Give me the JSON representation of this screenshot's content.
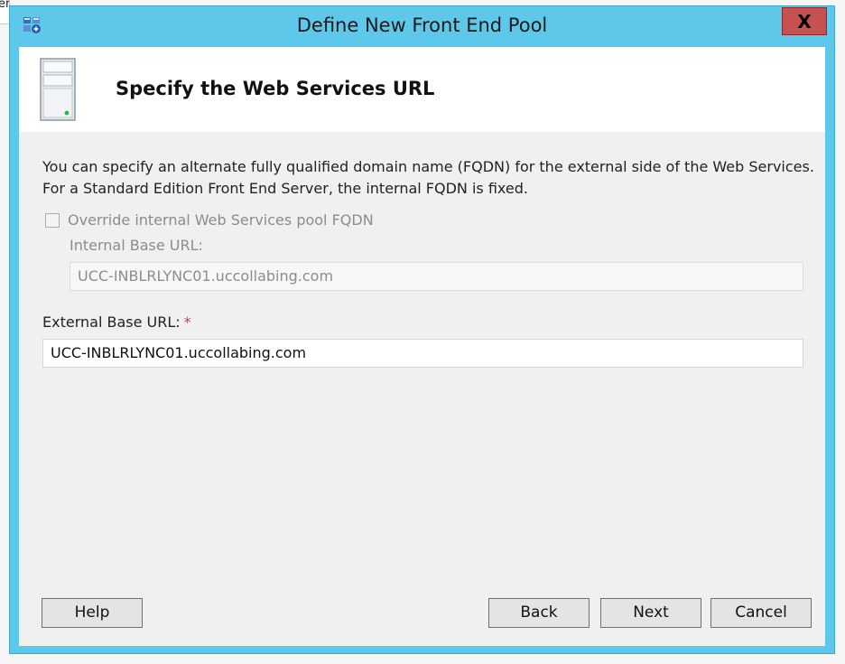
{
  "background": {
    "partial_text": "er"
  },
  "dialog": {
    "title": "Define New Front End Pool",
    "close_label": "X"
  },
  "header": {
    "title": "Specify the Web Services URL"
  },
  "description": {
    "line1": "You can specify an alternate fully qualified domain name (FQDN) for the external side of the Web Services.",
    "line2": "For a Standard Edition Front End Server, the internal FQDN is fixed."
  },
  "override": {
    "label": "Override internal Web Services pool FQDN",
    "checked": false
  },
  "internal": {
    "label": "Internal Base URL:",
    "value": "UCC-INBLRLYNC01.uccollabing.com"
  },
  "external": {
    "label": "External Base URL:",
    "required_marker": "*",
    "value": "UCC-INBLRLYNC01.uccollabing.com"
  },
  "buttons": {
    "help": "Help",
    "back": "Back",
    "next": "Next",
    "cancel": "Cancel"
  },
  "colors": {
    "title_bar": "#5ec8ea",
    "close_button": "#c75050",
    "required": "#d23b3b"
  }
}
